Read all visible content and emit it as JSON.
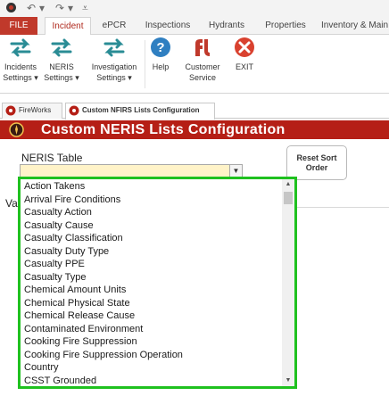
{
  "quick_access": {
    "app_icon": "app-logo-icon",
    "undo_icon": "undo-icon",
    "redo_icon": "redo-icon",
    "customize_icon": "customize-toolbar-icon"
  },
  "tabs": [
    {
      "label": "FILE"
    },
    {
      "label": "Incident"
    },
    {
      "label": "ePCR"
    },
    {
      "label": "Inspections"
    },
    {
      "label": "Hydrants"
    },
    {
      "label": "Properties"
    },
    {
      "label": "Inventory & Main"
    }
  ],
  "ribbon": {
    "buttons": [
      {
        "line1": "Incidents",
        "line2": "Settings ▾"
      },
      {
        "line1": "NERIS",
        "line2": "Settings ▾"
      },
      {
        "line1": "Investigation",
        "line2": "Settings ▾"
      },
      {
        "line1": "Help",
        "line2": ""
      },
      {
        "line1": "Customer",
        "line2": "Service"
      },
      {
        "line1": "EXIT",
        "line2": ""
      }
    ]
  },
  "doc_tabs": [
    {
      "label": "FireWorks"
    },
    {
      "label": "Custom NFIRS Lists Configuration"
    }
  ],
  "form": {
    "title": "Custom NERIS Lists Configuration",
    "table_label": "NERIS Table",
    "table_value": "",
    "reset_button": "Reset Sort Order",
    "value_label_partial": "Va"
  },
  "dropdown_options": [
    "Action Takens",
    "Arrival Fire Conditions",
    "Casualty Action",
    "Casualty Cause",
    "Casualty Classification",
    "Casualty Duty Type",
    "Casualty PPE",
    "Casualty Type",
    "Chemical Amount Units",
    "Chemical Physical State",
    "Chemical Release Cause",
    "Contaminated Environment",
    "Cooking Fire Suppression",
    "Cooking Fire Suppression Operation",
    "Country",
    "CSST Grounded"
  ],
  "colors": {
    "brand_red": "#b51f16",
    "file_tab": "#c0392b",
    "highlight_border": "#1fc11f",
    "combo_bg": "#fff3c8",
    "icon_teal": "#2a8c95",
    "icon_blue": "#2f7fc1"
  }
}
